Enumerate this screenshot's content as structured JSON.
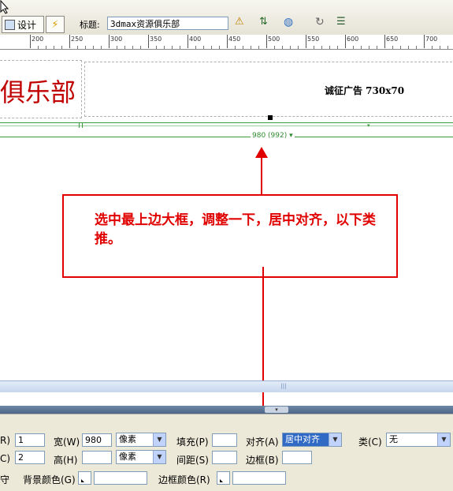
{
  "toolbar": {
    "design_label": "设计",
    "title_label": "标题:",
    "title_value": "3dmax资源俱乐部"
  },
  "ruler": {
    "labels": [
      "200",
      "250",
      "300",
      "350",
      "400",
      "450",
      "500",
      "550",
      "600",
      "650",
      "700"
    ]
  },
  "canvas": {
    "logo_text": "俱乐部",
    "ad_text": "诚征广告 730x70",
    "width_label": "980 (992) ▾"
  },
  "annotation": {
    "note": "选中最上边大框，调整一下，居中对齐，以下类推。"
  },
  "properties": {
    "row1_label_cut": "R)",
    "row1_value": "1",
    "width_label": "宽(W)",
    "width_value": "980",
    "width_unit": "像素",
    "padding_label": "填充(P)",
    "padding_value": "",
    "align_label": "对齐(A)",
    "align_value": "居中对齐",
    "class_label": "类(C)",
    "class_value": "无",
    "row2_label_cut": "C)",
    "row2_value": "2",
    "height_label": "高(H)",
    "height_value": "",
    "height_unit": "像素",
    "spacing_label": "间距(S)",
    "spacing_value": "",
    "border_label": "边框(B)",
    "border_value": "",
    "row3_label_cut": "守",
    "bgcolor_label": "背景颜色(G)",
    "bgcolor_value": "",
    "bordercolor_label": "边框颜色(R)",
    "bordercolor_value": ""
  },
  "colors": {
    "accent_red": "#e00000",
    "logo_red": "#c00000",
    "guide_green": "#3a9c3a",
    "panel_bg": "#ece9d8"
  }
}
